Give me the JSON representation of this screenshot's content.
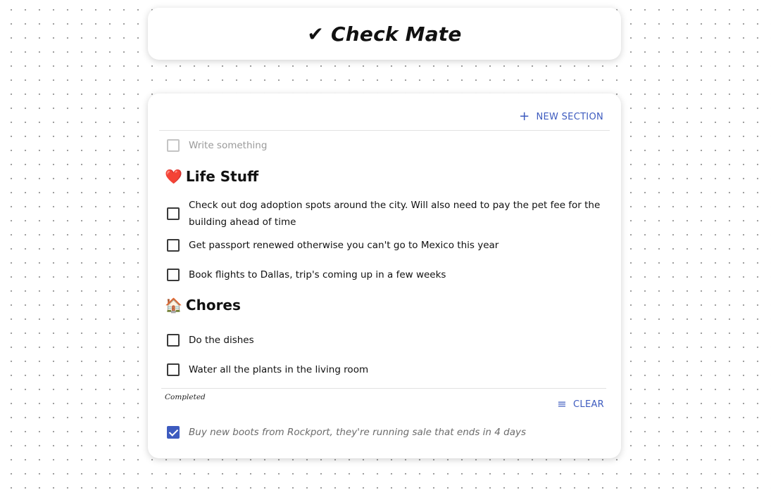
{
  "app": {
    "title": "✔ Check Mate"
  },
  "toolbar": {
    "new_section_label": "NEW SECTION",
    "new_section_icon": "plus-icon"
  },
  "new_item": {
    "placeholder": "Write something"
  },
  "sections": [
    {
      "emoji": "❤️",
      "title": "Life Stuff",
      "items": [
        {
          "text": "Check out dog adoption spots around the city. Will also need to pay the pet fee for the building ahead of time",
          "checked": false
        },
        {
          "text": "Get passport renewed otherwise you can't go to Mexico this year",
          "checked": false
        },
        {
          "text": "Book flights to Dallas, trip's coming up in a few weeks",
          "checked": false
        }
      ]
    },
    {
      "emoji": "🏠",
      "title": "Chores",
      "items": [
        {
          "text": "Do the dishes",
          "checked": false
        },
        {
          "text": "Water all the plants in the living room",
          "checked": false
        }
      ]
    }
  ],
  "completed": {
    "label": "Completed",
    "clear_label": "CLEAR",
    "clear_icon": "clear-all-icon",
    "items": [
      {
        "text": "Buy new boots from Rockport, they're running sale that ends in 4 days",
        "checked": true
      }
    ]
  },
  "colors": {
    "accent": "#3d5bbf",
    "text": "#111111",
    "muted": "#6b6b6b"
  }
}
